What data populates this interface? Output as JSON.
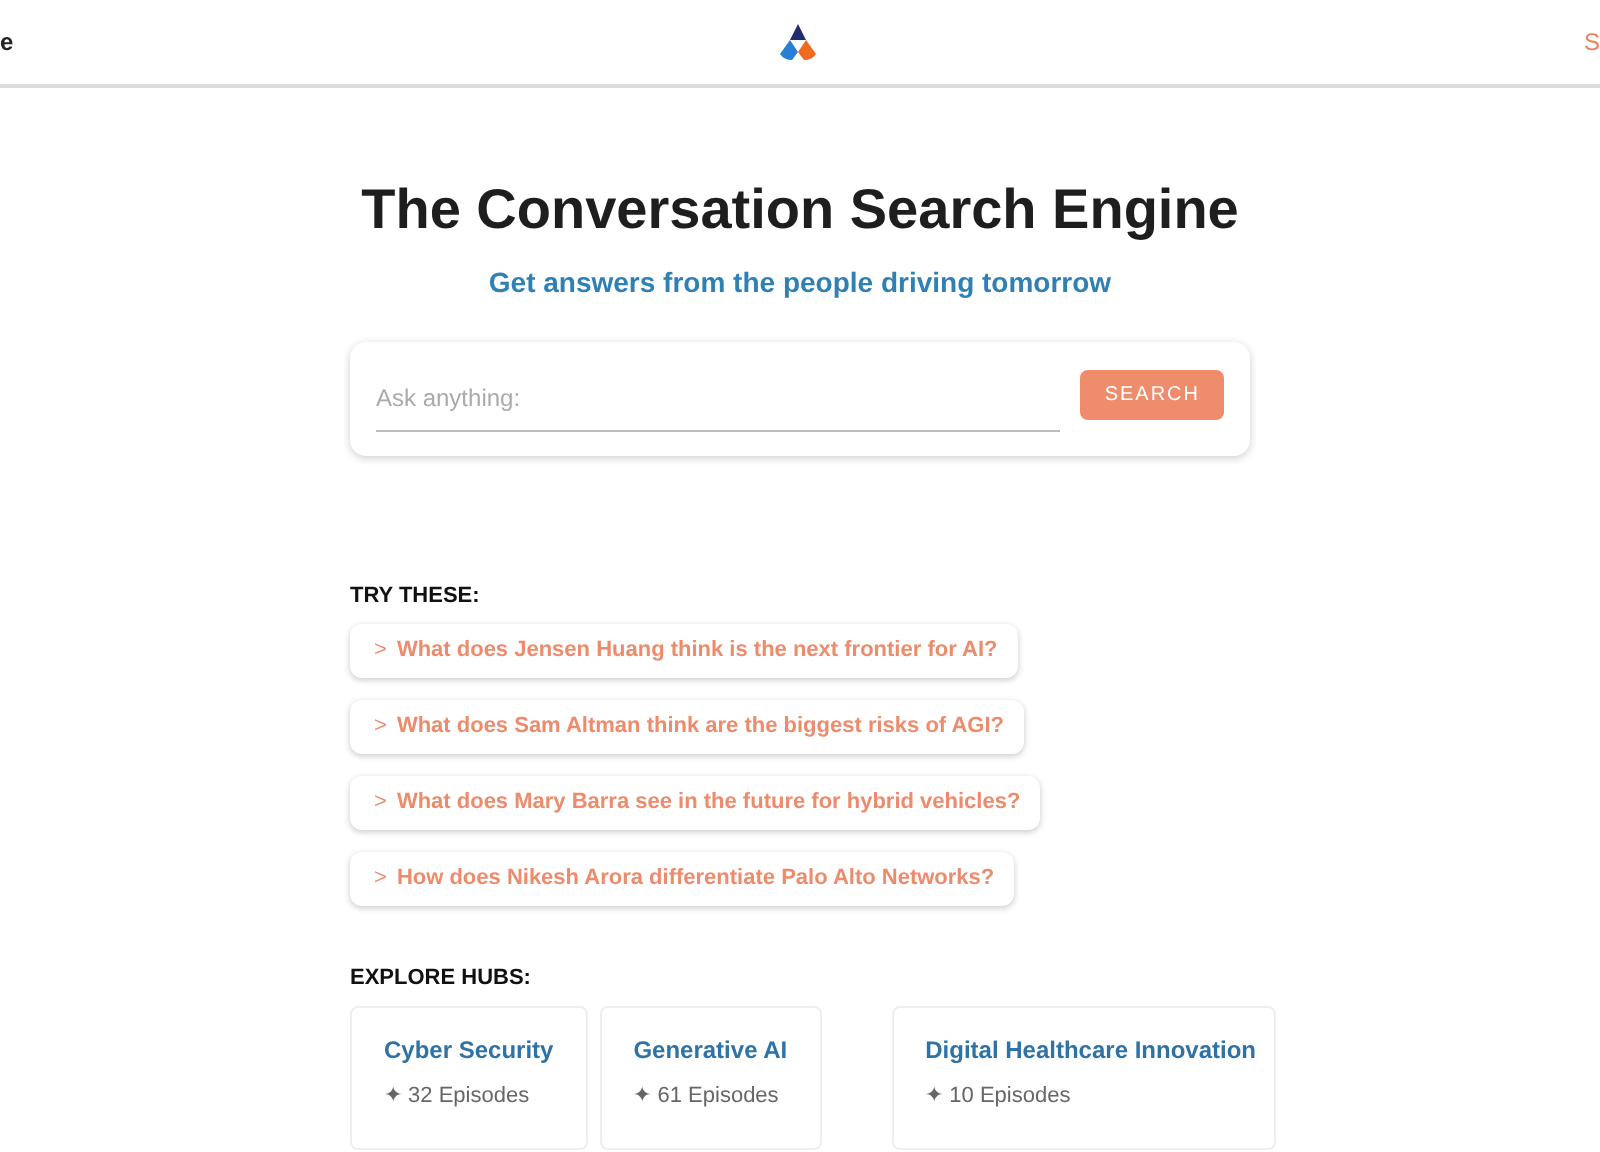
{
  "header": {
    "left_text": "e",
    "right_text": "S"
  },
  "hero": {
    "title": "The Conversation Search Engine",
    "subtitle": "Get answers from the people driving tomorrow"
  },
  "search": {
    "placeholder": "Ask anything:",
    "button": "SEARCH"
  },
  "try_these": {
    "heading": "TRY THESE:",
    "items": [
      {
        "icon": ">",
        "text": "What does Jensen Huang think is the next frontier for AI?"
      },
      {
        "icon": ">",
        "text": "What does Sam Altman think are the biggest risks of AGI?"
      },
      {
        "icon": ">",
        "text": "What does Mary Barra see in the future for hybrid vehicles?"
      },
      {
        "icon": ">",
        "text": "How does Nikesh Arora differentiate Palo Alto Networks?"
      }
    ]
  },
  "hubs": {
    "heading": "EXPLORE HUBS:",
    "items": [
      {
        "title": "Cyber Security",
        "episodes": "✦ 32 Episodes"
      },
      {
        "title": "Generative AI",
        "episodes": "✦ 61 Episodes"
      },
      {
        "title": "Digital Healthcare Innovation",
        "episodes": "✦ 10 Episodes"
      }
    ]
  }
}
